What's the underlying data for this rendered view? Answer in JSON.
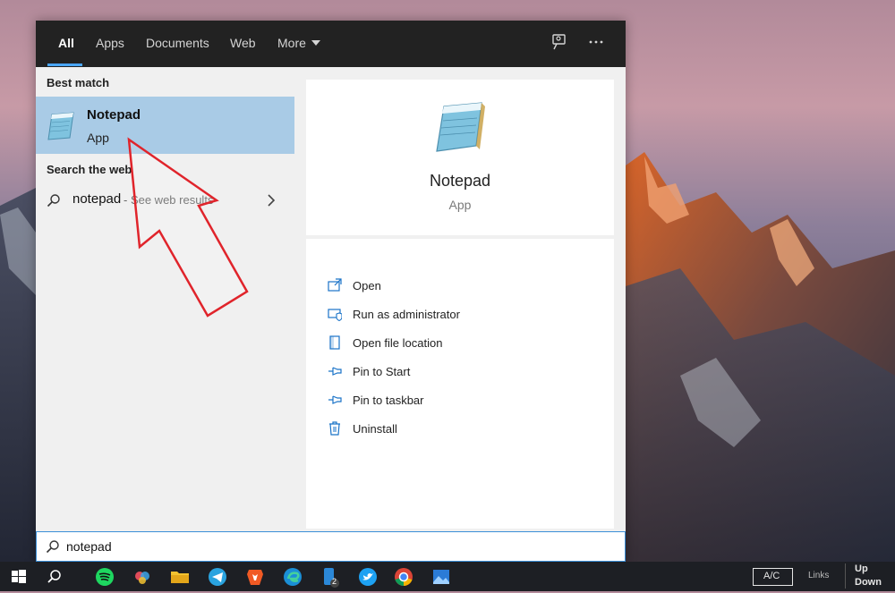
{
  "tabs": [
    {
      "label": "All",
      "active": true
    },
    {
      "label": "Apps"
    },
    {
      "label": "Documents"
    },
    {
      "label": "Web"
    },
    {
      "label": "More"
    }
  ],
  "top_icons": [
    "feedback-icon",
    "ellipsis-icon"
  ],
  "best_match": {
    "section_label": "Best match",
    "name": "Notepad",
    "type": "App"
  },
  "search_web": {
    "section_label": "Search the web",
    "query": "notepad",
    "suffix": "- See web results"
  },
  "preview": {
    "name": "Notepad",
    "type": "App"
  },
  "actions": [
    {
      "label": "Open",
      "icon": "open-icon"
    },
    {
      "label": "Run as administrator",
      "icon": "shield-icon"
    },
    {
      "label": "Open file location",
      "icon": "file-location-icon"
    },
    {
      "label": "Pin to Start",
      "icon": "pin-icon"
    },
    {
      "label": "Pin to taskbar",
      "icon": "pin-icon"
    },
    {
      "label": "Uninstall",
      "icon": "trash-icon"
    }
  ],
  "search": {
    "value": "notepad"
  },
  "taskbar": {
    "apps": [
      "windows-start-icon",
      "search-icon",
      "spotify-icon",
      "photos-app-icon",
      "file-explorer-icon",
      "telegram-icon",
      "brave-icon",
      "edge-icon",
      "phone-app-icon",
      "twitter-icon",
      "chrome-icon",
      "image-viewer-icon"
    ],
    "phone_badge": "2",
    "tray": {
      "ac_label": "A/C",
      "links_label": "Links",
      "up_label": "Up",
      "down_label": "Down"
    }
  },
  "colors": {
    "selected_bg": "#a9cbe6",
    "accent": "#3b8fd8",
    "annotation_arrow": "#e0242b"
  }
}
